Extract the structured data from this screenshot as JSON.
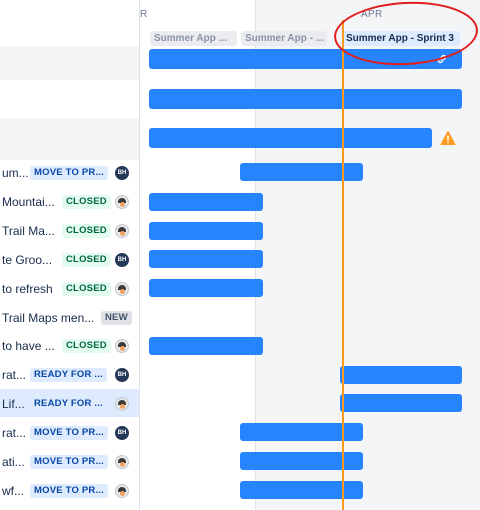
{
  "timeline": {
    "months": [
      {
        "label": "R"
      },
      {
        "label": "APR"
      }
    ],
    "sprints": [
      {
        "label": "Summer App ..."
      },
      {
        "label": "Summer App - ..."
      },
      {
        "label": "Summer App - Sprint 3"
      }
    ]
  },
  "rows": [
    {
      "title": "um...",
      "status": "MOVE TO PR...",
      "status_color": "blue",
      "assignee": "BH"
    },
    {
      "title": "Mountai...",
      "status": "CLOSED",
      "status_color": "green",
      "assignee": "photo"
    },
    {
      "title": "Trail Ma...",
      "status": "CLOSED",
      "status_color": "green",
      "assignee": "photo"
    },
    {
      "title": "te Groo...",
      "status": "CLOSED",
      "status_color": "green",
      "assignee": "BH"
    },
    {
      "title": "to refresh",
      "status": "CLOSED",
      "status_color": "green",
      "assignee": "photo"
    },
    {
      "title": "Trail Maps men...",
      "status": "NEW",
      "status_color": "gray",
      "assignee": ""
    },
    {
      "title": "to have ...",
      "status": "CLOSED",
      "status_color": "green",
      "assignee": "photo"
    },
    {
      "title": "rat...",
      "status": "READY FOR ...",
      "status_color": "blue",
      "assignee": "BH"
    },
    {
      "title": "Lif...",
      "status": "READY FOR ...",
      "status_color": "blue",
      "assignee": "photo"
    },
    {
      "title": "rat...",
      "status": "MOVE TO PR...",
      "status_color": "blue",
      "assignee": "BH"
    },
    {
      "title": "ati...",
      "status": "MOVE TO PR...",
      "status_color": "blue",
      "assignee": "photo"
    },
    {
      "title": "wf...",
      "status": "MOVE TO PR...",
      "status_color": "blue",
      "assignee": "photo"
    }
  ],
  "colors": {
    "bar": "#2684ff",
    "today_line": "#ff991f",
    "highlight_ring": "#e01e1e",
    "warning": "#ff991f"
  }
}
